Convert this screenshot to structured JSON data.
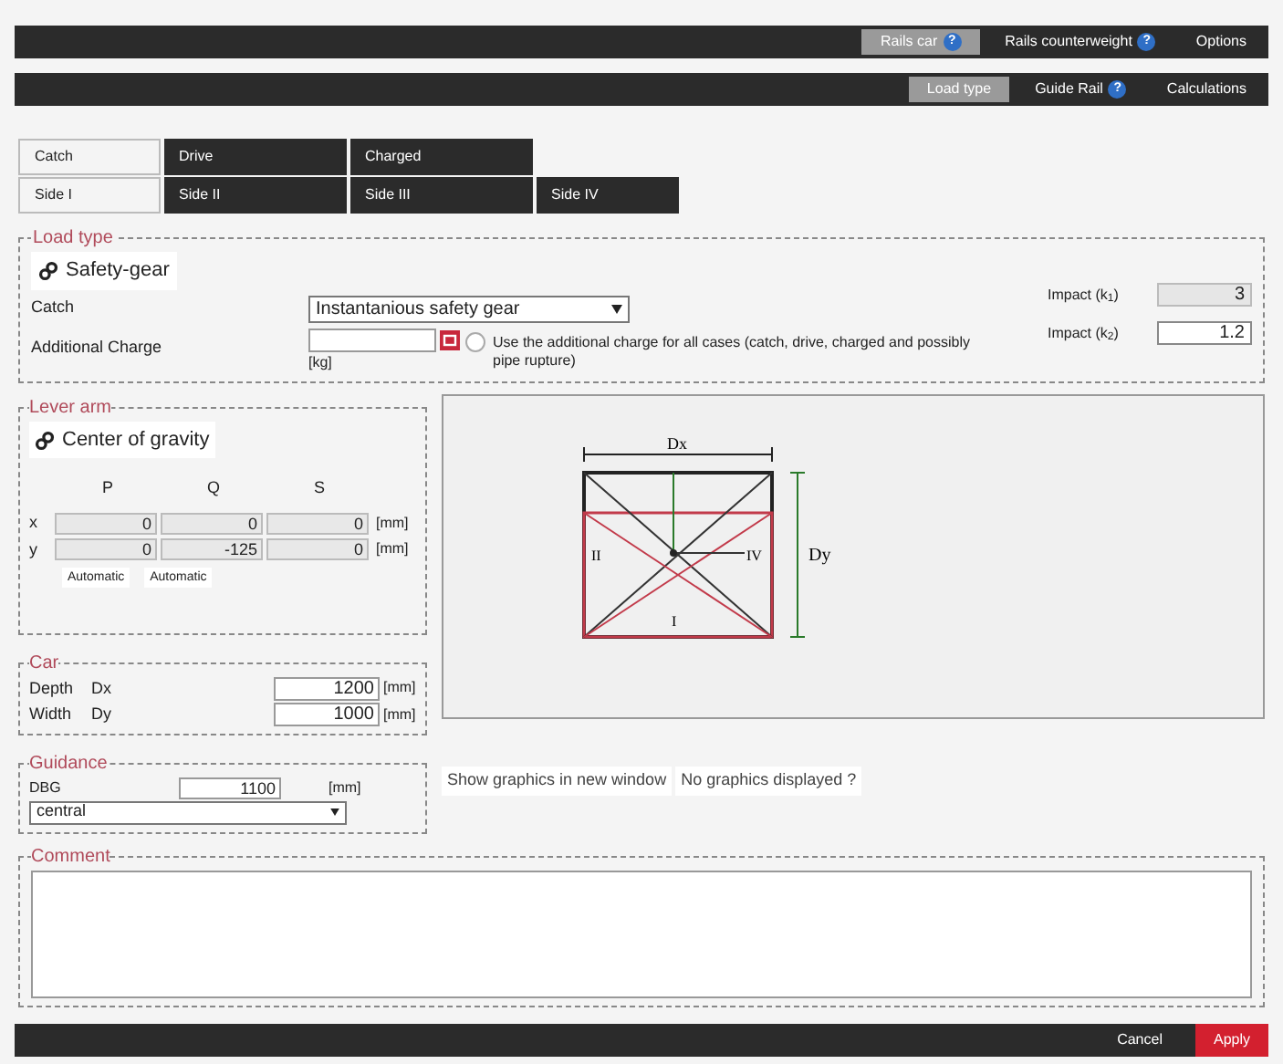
{
  "top_nav": [
    {
      "label": "Rails car",
      "help": "?",
      "selected": true
    },
    {
      "label": "Rails counterweight",
      "help": "?",
      "selected": false
    },
    {
      "label": "Options",
      "selected": false
    }
  ],
  "sub_nav": [
    {
      "label": "Load type",
      "selected": true
    },
    {
      "label": "Guide Rail",
      "help": "?",
      "selected": false
    },
    {
      "label": "Calculations",
      "selected": false
    }
  ],
  "case_tabs": [
    {
      "label": "Catch",
      "selected": true
    },
    {
      "label": "Drive",
      "selected": false
    },
    {
      "label": "Charged",
      "selected": false
    }
  ],
  "side_tabs": [
    {
      "label": "Side I",
      "selected": true
    },
    {
      "label": "Side II",
      "selected": false
    },
    {
      "label": "Side III",
      "selected": false
    },
    {
      "label": "Side IV",
      "selected": false
    }
  ],
  "load_type": {
    "legend": "Load type",
    "chip": "Safety-gear",
    "catch_label": "Catch",
    "catch_value": "Instantanious safety gear",
    "charge_label": "Additional Charge",
    "charge_unit": "[kg]",
    "all_cases": {
      "label": "Use the additional charge for all cases (catch, drive, charged and possibly pipe rupture)",
      "checked": false
    },
    "impacts": [
      {
        "label": "Impact (k$_{1}$)",
        "value": "3",
        "disabled": true
      },
      {
        "label": "Impact (k$_{2}$)",
        "value": "1.2",
        "disabled": false
      }
    ]
  },
  "lever_arm": {
    "legend": "Lever arm",
    "chip": "Center of gravity",
    "columns": [
      "P",
      "Q",
      "S"
    ],
    "rows": [
      {
        "label": "x",
        "values": [
          "0",
          "0",
          "0"
        ],
        "unit": "[mm]"
      },
      {
        "label": "y",
        "values": [
          "0",
          "-125",
          "0"
        ],
        "unit": "[mm]"
      }
    ],
    "buttons": [
      "Automatic",
      "Automatic"
    ]
  },
  "car": {
    "legend": "Car",
    "rows": [
      {
        "label": "Depth",
        "symbol": "Dx",
        "value": "1200",
        "unit": "[mm]"
      },
      {
        "label": "Width",
        "symbol": "Dy",
        "value": "1000",
        "unit": "[mm]"
      }
    ]
  },
  "diagram": {
    "labels": [
      "Dx",
      "II",
      "IV",
      "Dy",
      "I"
    ]
  },
  "guidance": {
    "legend": "Guidance",
    "dbg_label": "DBG",
    "dbg_value": "1100",
    "unit": "[mm]",
    "position": "central"
  },
  "graphics_buttons": [
    "Show graphics in new window",
    "No graphics displayed ?"
  ],
  "comment": {
    "legend": "Comment"
  },
  "footer": [
    {
      "label": "Cancel",
      "kind": "plain"
    },
    {
      "label": "Apply",
      "kind": "primary"
    }
  ]
}
